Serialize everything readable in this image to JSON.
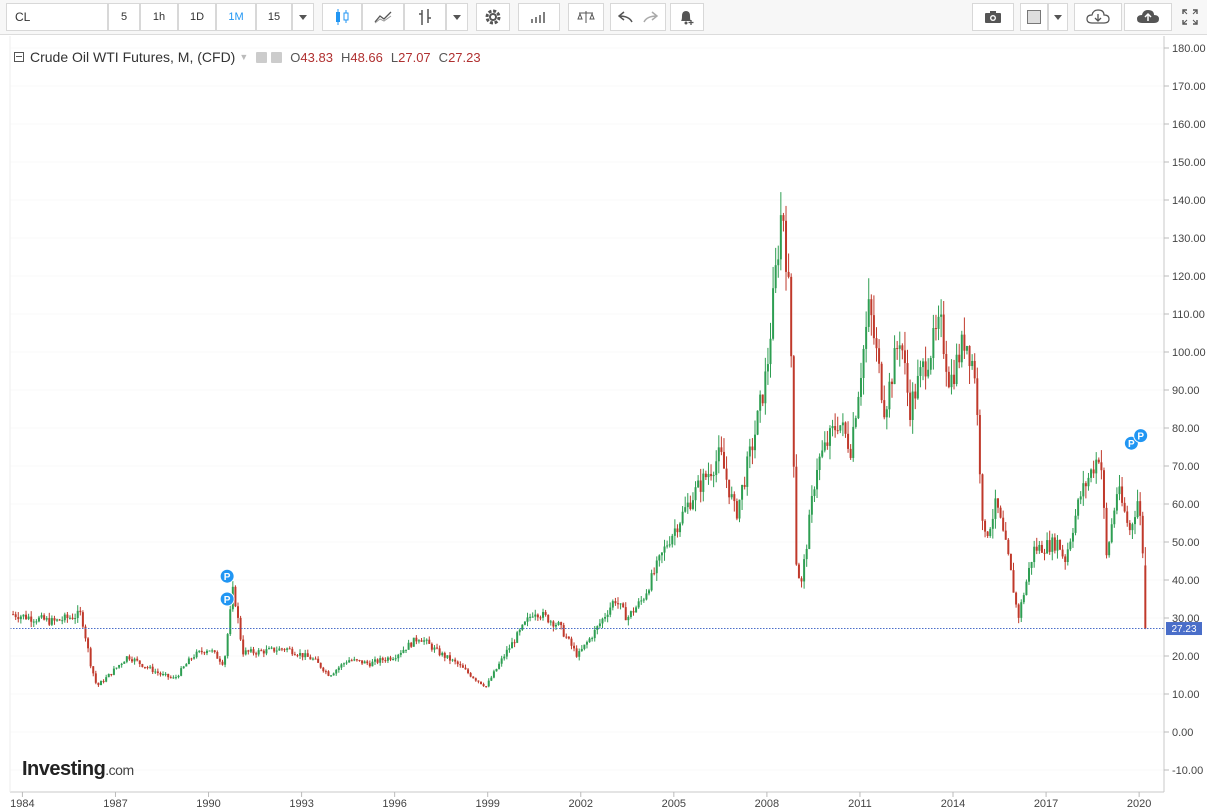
{
  "toolbar": {
    "symbol": "CL",
    "intervals": [
      "5",
      "1h",
      "1D",
      "1M",
      "15"
    ],
    "active_interval": "1M"
  },
  "legend": {
    "title": "Crude Oil WTI Futures, M, (CFD)",
    "open_label": "O",
    "open": "43.83",
    "high_label": "H",
    "high": "48.66",
    "low_label": "L",
    "low": "27.07",
    "close_label": "C",
    "close": "27.23"
  },
  "branding": {
    "logo_main": "Investing",
    "logo_suffix": ".com"
  },
  "colors": {
    "up": "#2e9e52",
    "down": "#c0392b",
    "accent": "#2196f3",
    "price_line": "#4a6ec9"
  },
  "chart_data": {
    "type": "candlestick",
    "title": "Crude Oil WTI Futures, M, (CFD)",
    "interval": "monthly",
    "x_tick_labels": [
      "1984",
      "1987",
      "1990",
      "1993",
      "1996",
      "1999",
      "2002",
      "2005",
      "2008",
      "2011",
      "2014",
      "2017",
      "2020"
    ],
    "y_tick_labels": [
      "-10.00",
      "0.00",
      "10.00",
      "20.00",
      "30.00",
      "40.00",
      "50.00",
      "60.00",
      "70.00",
      "80.00",
      "90.00",
      "100.00",
      "110.00",
      "120.00",
      "130.00",
      "140.00",
      "150.00",
      "160.00",
      "170.00",
      "180.00"
    ],
    "ylim": [
      -12,
      184
    ],
    "last_price_label": "27.23",
    "last_price": 27.23,
    "anchors": [
      [
        1983.7,
        31
      ],
      [
        1985.0,
        29
      ],
      [
        1985.9,
        31
      ],
      [
        1986.2,
        18
      ],
      [
        1986.4,
        12
      ],
      [
        1986.8,
        15
      ],
      [
        1987.4,
        20
      ],
      [
        1987.8,
        18
      ],
      [
        1988.5,
        15
      ],
      [
        1988.9,
        14
      ],
      [
        1989.5,
        20
      ],
      [
        1990.0,
        22
      ],
      [
        1990.5,
        18
      ],
      [
        1990.8,
        38
      ],
      [
        1991.1,
        21
      ],
      [
        1991.5,
        21
      ],
      [
        1992.5,
        22
      ],
      [
        1993.4,
        19
      ],
      [
        1993.9,
        15
      ],
      [
        1994.5,
        19
      ],
      [
        1995.2,
        18
      ],
      [
        1996.0,
        20
      ],
      [
        1996.8,
        25
      ],
      [
        1997.4,
        21
      ],
      [
        1998.0,
        18
      ],
      [
        1998.6,
        14
      ],
      [
        1998.95,
        12
      ],
      [
        1999.6,
        21
      ],
      [
        2000.5,
        32
      ],
      [
        2001.3,
        28
      ],
      [
        2001.9,
        20
      ],
      [
        2002.5,
        27
      ],
      [
        2003.1,
        35
      ],
      [
        2003.5,
        30
      ],
      [
        2004.0,
        35
      ],
      [
        2004.8,
        50
      ],
      [
        2005.6,
        62
      ],
      [
        2006.5,
        73
      ],
      [
        2007.0,
        57
      ],
      [
        2007.6,
        78
      ],
      [
        2008.0,
        95
      ],
      [
        2008.5,
        140
      ],
      [
        2008.75,
        110
      ],
      [
        2008.95,
        45
      ],
      [
        2009.1,
        38
      ],
      [
        2009.6,
        70
      ],
      [
        2010.3,
        82
      ],
      [
        2010.7,
        75
      ],
      [
        2011.3,
        112
      ],
      [
        2011.8,
        85
      ],
      [
        2012.3,
        105
      ],
      [
        2012.6,
        85
      ],
      [
        2013.0,
        95
      ],
      [
        2013.6,
        107
      ],
      [
        2013.9,
        92
      ],
      [
        2014.4,
        104
      ],
      [
        2014.7,
        95
      ],
      [
        2015.0,
        50
      ],
      [
        2015.4,
        60
      ],
      [
        2015.8,
        45
      ],
      [
        2016.1,
        30
      ],
      [
        2016.6,
        48
      ],
      [
        2017.4,
        50
      ],
      [
        2017.6,
        45
      ],
      [
        2018.1,
        62
      ],
      [
        2018.75,
        74
      ],
      [
        2018.95,
        46
      ],
      [
        2019.3,
        64
      ],
      [
        2019.7,
        53
      ],
      [
        2019.95,
        61
      ],
      [
        2020.1,
        52
      ],
      [
        2020.2,
        27.23
      ]
    ],
    "markers": [
      {
        "date": 1990.6,
        "price": 35,
        "label": "P"
      },
      {
        "date": 1990.6,
        "price": 41,
        "label": "P"
      },
      {
        "date": 2019.75,
        "price": 76,
        "label": "P"
      },
      {
        "date": 2020.05,
        "price": 78,
        "label": "P"
      }
    ]
  }
}
